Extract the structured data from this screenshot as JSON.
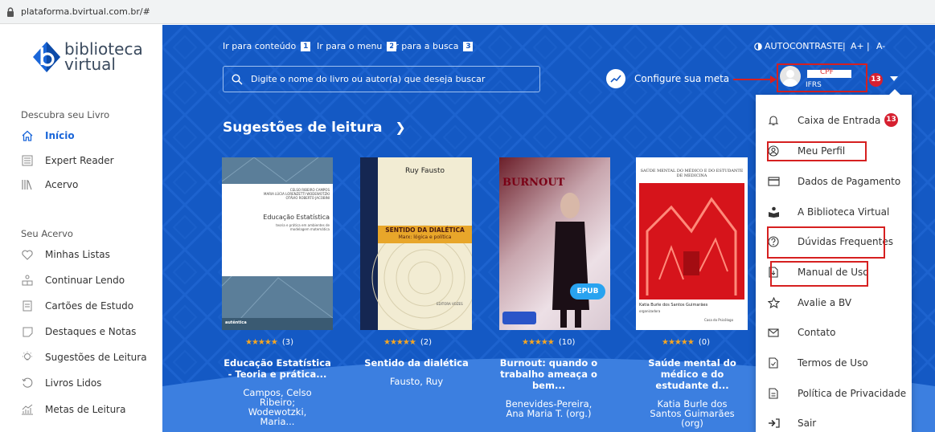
{
  "browser": {
    "url": "plataforma.bvirtual.com.br/#"
  },
  "logo": {
    "line1": "biblioteca",
    "line2": "virtual"
  },
  "sidebar": {
    "section1": "Descubra seu Livro",
    "items1": [
      {
        "label": "Início",
        "icon": "home-icon"
      },
      {
        "label": "Expert Reader",
        "icon": "list-icon"
      },
      {
        "label": "Acervo",
        "icon": "library-icon"
      }
    ],
    "section2": "Seu Acervo",
    "items2": [
      {
        "label": "Minhas Listas",
        "icon": "heart-icon"
      },
      {
        "label": "Continuar Lendo",
        "icon": "reader-icon"
      },
      {
        "label": "Cartões de Estudo",
        "icon": "card-icon"
      },
      {
        "label": "Destaques e Notas",
        "icon": "note-icon"
      },
      {
        "label": "Sugestões de Leitura",
        "icon": "bulb-icon"
      },
      {
        "label": "Livros Lidos",
        "icon": "history-icon"
      },
      {
        "label": "Metas de Leitura",
        "icon": "chart-icon"
      }
    ]
  },
  "header": {
    "skip": [
      {
        "label": "Ir para conteúdo",
        "num": "1"
      },
      {
        "label": "Ir para o menu",
        "num": "2"
      },
      {
        "label": "Ir para a busca",
        "num": "3"
      }
    ],
    "contrast": "AUTOCONTRASTE",
    "font_up": "A+",
    "font_down": "A-",
    "search_placeholder": "Digite o nome do livro ou autor(a) que deseja buscar",
    "meta": "Configure sua meta",
    "user": {
      "cpf": "CPF",
      "inst": "IFRS",
      "badge": "13"
    }
  },
  "main": {
    "section_title": "Sugestões de leitura",
    "books": [
      {
        "stars": "★★★★★",
        "count": "(3)",
        "title": "Educação Estatística - Teoria e prática...",
        "author": "Campos, Celso Ribeiro; Wodewotzki, Maria...",
        "cover": {
          "authors": "CELSO RIBEIRO CAMPOS\nMARIA LÚCIA LORENZETTI WODEWOTZKI\nOTÁVIO ROBERTO JACOBINI",
          "title": "Educação Estatística",
          "sub": "teoria e prática em ambientes de modelagem matemática",
          "pub": "autêntica"
        }
      },
      {
        "stars": "★★★★★",
        "count": "(2)",
        "title": "Sentido da dialética",
        "author": "Fausto, Ruy",
        "cover": {
          "author": "Ruy Fausto",
          "title": "SENTIDO DA DIALÉTICA",
          "sub": "Marx: lógica e política",
          "pub": "EDITORA VOZES"
        }
      },
      {
        "stars": "★★★★★",
        "count": "(10)",
        "title": "Burnout: quando o trabalho ameaça o bem...",
        "author": "Benevides-Pereira, Ana Maria T. (org.)",
        "cover": {
          "title": "BURNOUT",
          "badge": "EPUB"
        }
      },
      {
        "stars": "★★★★★",
        "count": "(0)",
        "title": "Saúde mental do médico e do estudante d...",
        "author": "Katia Burle dos Santos Guimarães (org)",
        "cover": {
          "title": "SAÚDE MENTAL DO MÉDICO E DO ESTUDANTE DE MEDICINA",
          "author": "Katia Burle dos Santos Guimarães",
          "role": "organizadora",
          "pub": "Casa do Psicólogo"
        }
      }
    ]
  },
  "dropdown": {
    "items": [
      {
        "label": "Caixa de Entrada",
        "icon": "bell-icon",
        "badge": "13"
      },
      {
        "label": "Meu Perfil",
        "icon": "user-circle-icon"
      },
      {
        "label": "Dados de Pagamento",
        "icon": "credit-card-icon"
      },
      {
        "label": "A Biblioteca Virtual",
        "icon": "readers-icon"
      },
      {
        "label": "Dúvidas Frequentes",
        "icon": "question-icon"
      },
      {
        "label": "Manual de Uso",
        "icon": "document-icon"
      },
      {
        "label": "Avalie a BV",
        "icon": "star-icon"
      },
      {
        "label": "Contato",
        "icon": "mail-icon"
      },
      {
        "label": "Termos de Uso",
        "icon": "terms-icon"
      },
      {
        "label": "Política de Privacidade",
        "icon": "policy-icon"
      },
      {
        "label": "Sair",
        "icon": "logout-icon"
      }
    ]
  },
  "colors": {
    "primary": "#1459c4",
    "accent": "#1a66d9",
    "badge": "#d62030",
    "annotation": "#d62020",
    "star": "#f5a623"
  }
}
